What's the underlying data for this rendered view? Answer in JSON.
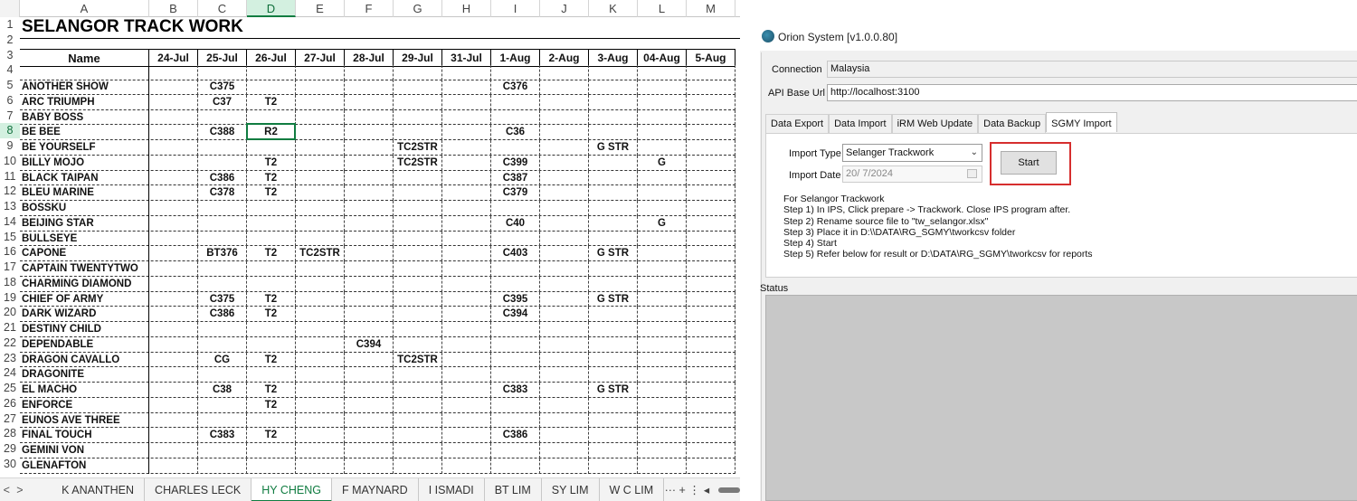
{
  "excel": {
    "columns": [
      "A",
      "B",
      "C",
      "D",
      "E",
      "F",
      "G",
      "H",
      "I",
      "J",
      "K",
      "L",
      "M"
    ],
    "selected_column": "D",
    "selected_row": "8",
    "title": "SELANGOR TRACK WORK",
    "header": {
      "name": "Name",
      "dates": [
        "24-Jul",
        "25-Jul",
        "26-Jul",
        "27-Jul",
        "28-Jul",
        "29-Jul",
        "31-Jul",
        "1-Aug",
        "2-Aug",
        "3-Aug",
        "04-Aug",
        "5-Aug"
      ]
    },
    "row_numbers": [
      "1",
      "2",
      "3",
      "4",
      "5",
      "6",
      "7",
      "8",
      "9",
      "10",
      "11",
      "12",
      "13",
      "14",
      "15",
      "16",
      "17",
      "18",
      "19",
      "20",
      "21",
      "22",
      "23",
      "24",
      "25",
      "26",
      "27",
      "28",
      "29",
      "30"
    ],
    "rows": [
      {
        "name": "ANOTHER SHOW",
        "cells": [
          "",
          "C375",
          "",
          "",
          "",
          "",
          "",
          "C376",
          "",
          "",
          "",
          ""
        ]
      },
      {
        "name": "ARC TRIUMPH",
        "cells": [
          "",
          "C37",
          "T2",
          "",
          "",
          "",
          "",
          "",
          "",
          "",
          "",
          ""
        ]
      },
      {
        "name": "BABY BOSS",
        "cells": [
          "",
          "",
          "",
          "",
          "",
          "",
          "",
          "",
          "",
          "",
          "",
          ""
        ]
      },
      {
        "name": "BE BEE",
        "cells": [
          "",
          "C388",
          "R2",
          "",
          "",
          "",
          "",
          "C36",
          "",
          "",
          "",
          ""
        ]
      },
      {
        "name": "BE YOURSELF",
        "cells": [
          "",
          "",
          "",
          "",
          "",
          "TC2STR",
          "",
          "",
          "",
          "G STR",
          "",
          ""
        ]
      },
      {
        "name": "BILLY MOJO",
        "cells": [
          "",
          "",
          "T2",
          "",
          "",
          "TC2STR",
          "",
          "C399",
          "",
          "",
          "G",
          ""
        ]
      },
      {
        "name": "BLACK TAIPAN",
        "cells": [
          "",
          "C386",
          "T2",
          "",
          "",
          "",
          "",
          "C387",
          "",
          "",
          "",
          ""
        ]
      },
      {
        "name": "BLEU MARINE",
        "cells": [
          "",
          "C378",
          "T2",
          "",
          "",
          "",
          "",
          "C379",
          "",
          "",
          "",
          ""
        ]
      },
      {
        "name": "BOSSKU",
        "cells": [
          "",
          "",
          "",
          "",
          "",
          "",
          "",
          "",
          "",
          "",
          "",
          ""
        ]
      },
      {
        "name": "BEIJING STAR",
        "cells": [
          "",
          "",
          "",
          "",
          "",
          "",
          "",
          "C40",
          "",
          "",
          "G",
          ""
        ]
      },
      {
        "name": "BULLSEYE",
        "cells": [
          "",
          "",
          "",
          "",
          "",
          "",
          "",
          "",
          "",
          "",
          "",
          ""
        ]
      },
      {
        "name": "CAPONE",
        "cells": [
          "",
          "BT376",
          "T2",
          "TC2STR",
          "",
          "",
          "",
          "C403",
          "",
          "G STR",
          "",
          ""
        ]
      },
      {
        "name": "CAPTAIN TWENTYTWO",
        "cells": [
          "",
          "",
          "",
          "",
          "",
          "",
          "",
          "",
          "",
          "",
          "",
          ""
        ]
      },
      {
        "name": "CHARMING DIAMOND",
        "cells": [
          "",
          "",
          "",
          "",
          "",
          "",
          "",
          "",
          "",
          "",
          "",
          ""
        ]
      },
      {
        "name": "CHIEF OF ARMY",
        "cells": [
          "",
          "C375",
          "T2",
          "",
          "",
          "",
          "",
          "C395",
          "",
          "G STR",
          "",
          ""
        ]
      },
      {
        "name": "DARK WIZARD",
        "cells": [
          "",
          "C386",
          "T2",
          "",
          "",
          "",
          "",
          "C394",
          "",
          "",
          "",
          ""
        ]
      },
      {
        "name": "DESTINY CHILD",
        "cells": [
          "",
          "",
          "",
          "",
          "",
          "",
          "",
          "",
          "",
          "",
          "",
          ""
        ]
      },
      {
        "name": "DEPENDABLE",
        "cells": [
          "",
          "",
          "",
          "",
          "C394",
          "",
          "",
          "",
          "",
          "",
          "",
          ""
        ]
      },
      {
        "name": "DRAGON CAVALLO",
        "cells": [
          "",
          "CG",
          "T2",
          "",
          "",
          "TC2STR",
          "",
          "",
          "",
          "",
          "",
          ""
        ]
      },
      {
        "name": "DRAGONITE",
        "cells": [
          "",
          "",
          "",
          "",
          "",
          "",
          "",
          "",
          "",
          "",
          "",
          ""
        ]
      },
      {
        "name": "EL MACHO",
        "cells": [
          "",
          "C38",
          "T2",
          "",
          "",
          "",
          "",
          "C383",
          "",
          "G STR",
          "",
          ""
        ]
      },
      {
        "name": "ENFORCE",
        "cells": [
          "",
          "",
          "T2",
          "",
          "",
          "",
          "",
          "",
          "",
          "",
          "",
          ""
        ]
      },
      {
        "name": "EUNOS AVE THREE",
        "cells": [
          "",
          "",
          "",
          "",
          "",
          "",
          "",
          "",
          "",
          "",
          "",
          ""
        ]
      },
      {
        "name": "FINAL TOUCH",
        "cells": [
          "",
          "C383",
          "T2",
          "",
          "",
          "",
          "",
          "C386",
          "",
          "",
          "",
          ""
        ]
      },
      {
        "name": "GEMINI VON",
        "cells": [
          "",
          "",
          "",
          "",
          "",
          "",
          "",
          "",
          "",
          "",
          "",
          ""
        ]
      },
      {
        "name": "GLENAFTON",
        "cells": [
          "",
          "",
          "",
          "",
          "",
          "",
          "",
          "",
          "",
          "",
          "",
          ""
        ]
      }
    ],
    "sheet_tabs": [
      "K ANANTHEN",
      "CHARLES LECK",
      "HY CHENG",
      "F MAYNARD",
      "I ISMADI",
      "BT LIM",
      "SY LIM",
      "W C LIM"
    ],
    "active_sheet": "HY CHENG",
    "nav_prev": "<",
    "nav_next": ">",
    "more_tabs": "···",
    "add_sheet": "+",
    "options": "⋮",
    "scroll_left": "◂"
  },
  "orion": {
    "window_title": "Orion System [v1.0.0.80]",
    "connection_label": "Connection",
    "connection_value": "Malaysia",
    "api_label": "API Base Url",
    "api_value": "http://localhost:3100",
    "tabs": [
      "Data Export",
      "Data Import",
      "iRM Web Update",
      "Data Backup",
      "SGMY Import"
    ],
    "active_tab": "SGMY Import",
    "import_type_label": "Import Type",
    "import_type_value": "Selanger Trackwork",
    "import_date_label": "Import Date",
    "import_date_value": "20/ 7/2024",
    "start_button": "Start",
    "instructions": [
      "For Selangor Trackwork",
      "Step 1) In IPS, Click prepare -> Trackwork. Close IPS program after.",
      "Step 2) Rename source file to \"tw_selangor.xlsx\"",
      "Step 3) Place it in D:\\\\DATA\\RG_SGMY\\tworkcsv folder",
      "Step 4) Start",
      "Step 5) Refer below for result or D:\\DATA\\RG_SGMY\\tworkcsv for reports"
    ],
    "status_label": "Status",
    "colors": {
      "highlight": "#d62e2e",
      "excel_accent": "#107c41"
    }
  }
}
